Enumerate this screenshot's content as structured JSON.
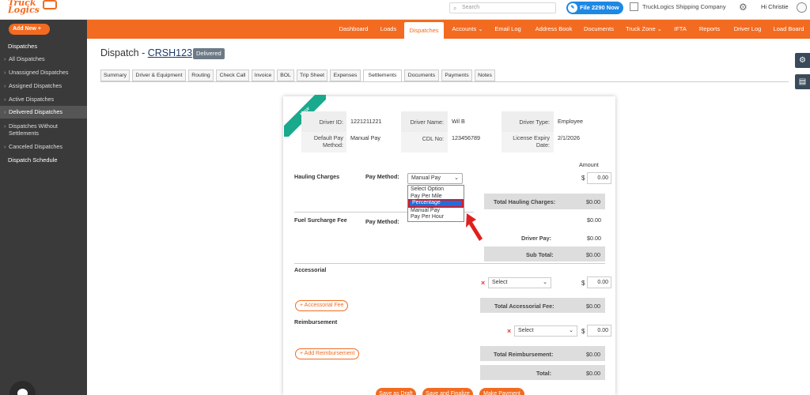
{
  "brand": {
    "line1": "Truck",
    "line2": "Logics"
  },
  "header": {
    "search_placeholder": "Search",
    "file_button": "File 2290 Now",
    "company": "TruckLogics Shipping Company",
    "greeting": "Hi Christie"
  },
  "nav": [
    "Dashboard",
    "Loads",
    "Dispatches",
    "Accounts ⌄",
    "Email Log",
    "Address Book",
    "Documents",
    "Truck Zone ⌄",
    "IFTA",
    "Reports",
    "Driver Log",
    "Load Board"
  ],
  "nav_active": "Dispatches",
  "sidebar": {
    "add_new": "Add New +",
    "title": "Dispatches",
    "items": [
      "All Dispatches",
      "Unassigned Dispatches",
      "Assigned Dispatches",
      "Active Dispatches",
      "Delivered Dispatches",
      "Dispatches Without",
      "Settlements",
      "Canceled Dispatches"
    ],
    "schedule": "Dispatch Schedule"
  },
  "page": {
    "prefix": "Dispatch - ",
    "id": "CRSH123",
    "status": "Delivered"
  },
  "tabs": [
    "Summary",
    "Driver & Equipment",
    "Routing",
    "Check Call",
    "Invoice",
    "BOL",
    "Trip Sheet",
    "Expenses",
    "Settlements",
    "Documents",
    "Payments",
    "Notes"
  ],
  "tab_active": "Settlements",
  "ribbon": "New",
  "driver": {
    "id_label": "Driver ID:",
    "id": "1221211221",
    "name_label": "Driver Name:",
    "name": "Wil B",
    "type_label": "Driver Type:",
    "type": "Employee",
    "pay_label_1": "Default Pay",
    "pay_label_2": "Method:",
    "pay": "Manual Pay",
    "cdl_label": "CDL No:",
    "cdl": "123456789",
    "exp_label_1": "License Expiry",
    "exp_label_2": "Date:",
    "exp": "2/1/2026"
  },
  "settlement": {
    "amount_header": "Amount",
    "hauling_label": "Hauling Charges",
    "pay_method_label": "Pay Method:",
    "pay_method_value": "Manual Pay",
    "hauling_amount": "0.00",
    "dropdown_options": [
      "Select Option",
      "Pay Per Mile",
      "Percentage",
      "Manual Pay",
      "Pay Per Hour"
    ],
    "dropdown_highlight": "Percentage",
    "total_hauling_label": "Total Hauling Charges:",
    "total_hauling": "$0.00",
    "fuel_label": "Fuel Surcharge Fee",
    "fuel_pay_label": "Pay Method:",
    "fuel_amount": "$0.00",
    "driver_pay_label": "Driver Pay:",
    "driver_pay": "$0.00",
    "subtotal_label": "Sub Total:",
    "subtotal": "$0.00",
    "accessorial_label": "Accessorial",
    "accessorial_select": "Select",
    "accessorial_amount": "0.00",
    "accessorial_btn": "+ Accessorial Fee",
    "total_accessorial_label": "Total Accessorial Fee:",
    "total_accessorial": "$0.00",
    "reimb_label": "Reimbursement",
    "reimb_select": "Select",
    "reimb_amount": "0.00",
    "reimb_btn": "+ Add Reimbursement",
    "total_reimb_label": "Total Reimbursement:",
    "total_reimb": "$0.00",
    "total_label": "Total:",
    "total": "$0.00",
    "currency": "$"
  },
  "footer_buttons": [
    "Save as Draft",
    "Save and Finalize",
    "Make Payment"
  ],
  "colors": {
    "brand": "#f26b21",
    "sidebar": "#3a3a3a",
    "ribbon": "#19a98c",
    "highlight": "#d31b2d"
  }
}
